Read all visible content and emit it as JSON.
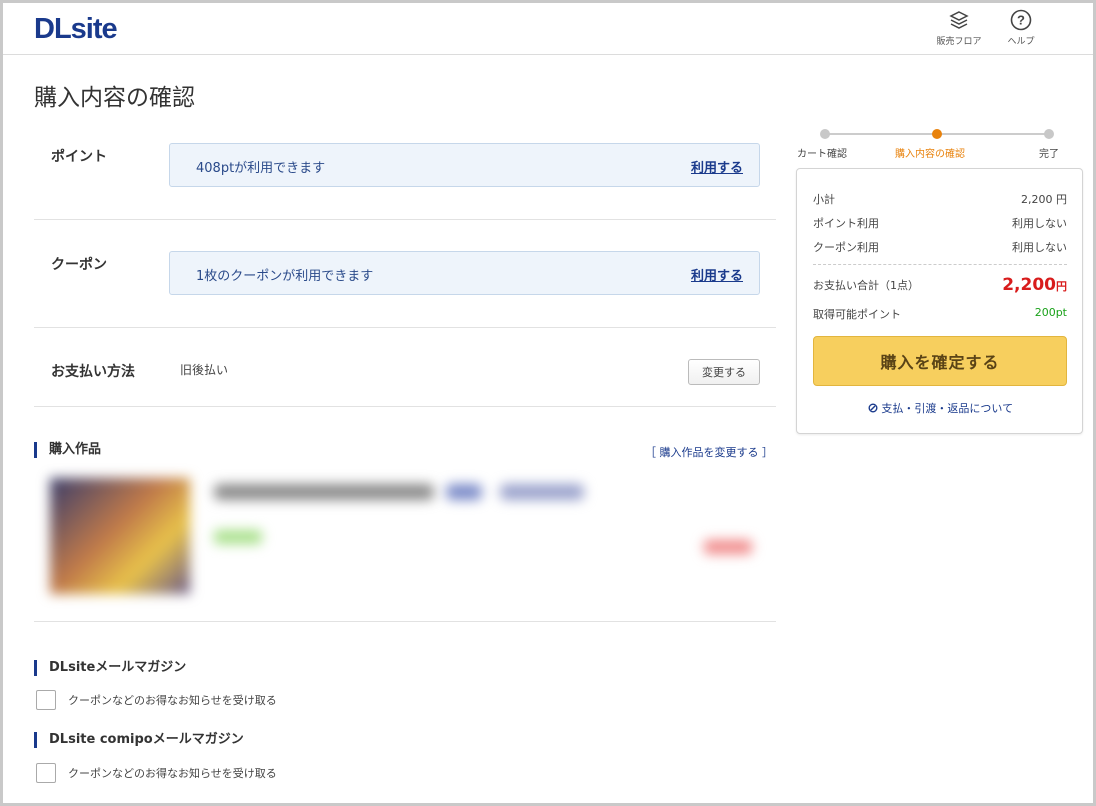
{
  "header": {
    "logo": "DLsite",
    "nav": [
      {
        "icon": "floor-icon",
        "label": "販売フロア"
      },
      {
        "icon": "help-icon",
        "label": "ヘルプ"
      }
    ]
  },
  "page": {
    "title": "購入内容の確認"
  },
  "points": {
    "label": "ポイント",
    "message": "408ptが利用できます",
    "link": "利用する"
  },
  "coupon": {
    "label": "クーポン",
    "message": "1枚のクーポンが利用できます",
    "link": "利用する"
  },
  "payment": {
    "label": "お支払い方法",
    "method": "旧後払い",
    "change": "変更する"
  },
  "works": {
    "heading": "購入作品",
    "change_link": "［ 購入作品を変更する ］"
  },
  "newsletters": [
    {
      "heading": "DLsiteメールマガジン",
      "checkbox_label": "クーポンなどのお得なお知らせを受け取る",
      "checked": false
    },
    {
      "heading": "DLsite comipoメールマガジン",
      "checkbox_label": "クーポンなどのお得なお知らせを受け取る",
      "checked": false
    }
  ],
  "steps": {
    "items": [
      "カート確認",
      "購入内容の確認",
      "完了"
    ],
    "active_index": 1,
    "active_color": "#e8820c"
  },
  "summary": {
    "subtotal_label": "小計",
    "subtotal_value": "2,200 円",
    "point_use_label": "ポイント利用",
    "point_use_value": "利用しない",
    "coupon_use_label": "クーポン利用",
    "coupon_use_value": "利用しない",
    "total_label": "お支払い合計（1点）",
    "total_value": "2,200",
    "total_unit": "円",
    "earn_label": "取得可能ポイント",
    "earn_value": "200pt",
    "buy_button": "購入を確定する",
    "about_link": "支払・引渡・返品について",
    "total_color": "#d81c1c",
    "points_color": "#1aa21a"
  }
}
